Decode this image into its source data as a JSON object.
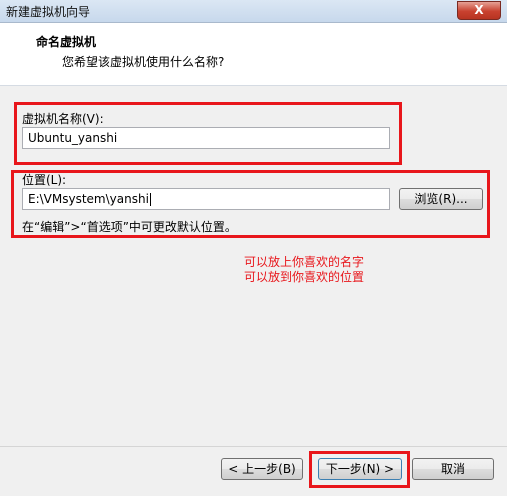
{
  "window": {
    "title": "新建虚拟机向导",
    "close_glyph": "X"
  },
  "header": {
    "title": "命名虚拟机",
    "subtitle": "您希望该虚拟机使用什么名称?"
  },
  "name_field": {
    "label": "虚拟机名称(V):",
    "value": "Ubuntu_yanshi"
  },
  "location_field": {
    "label": "位置(L):",
    "value": "E:\\VMsystem\\yanshi",
    "browse_label": "浏览(R)...",
    "hint": "在“编辑”>“首选项”中可更改默认位置。"
  },
  "annotation": {
    "line1": "可以放上你喜欢的名字",
    "line2": "可以放到你喜欢的位置",
    "color": "#e8161b"
  },
  "footer": {
    "back_label": "< 上一步(B)",
    "next_label": "下一步(N) >",
    "cancel_label": "取消"
  }
}
